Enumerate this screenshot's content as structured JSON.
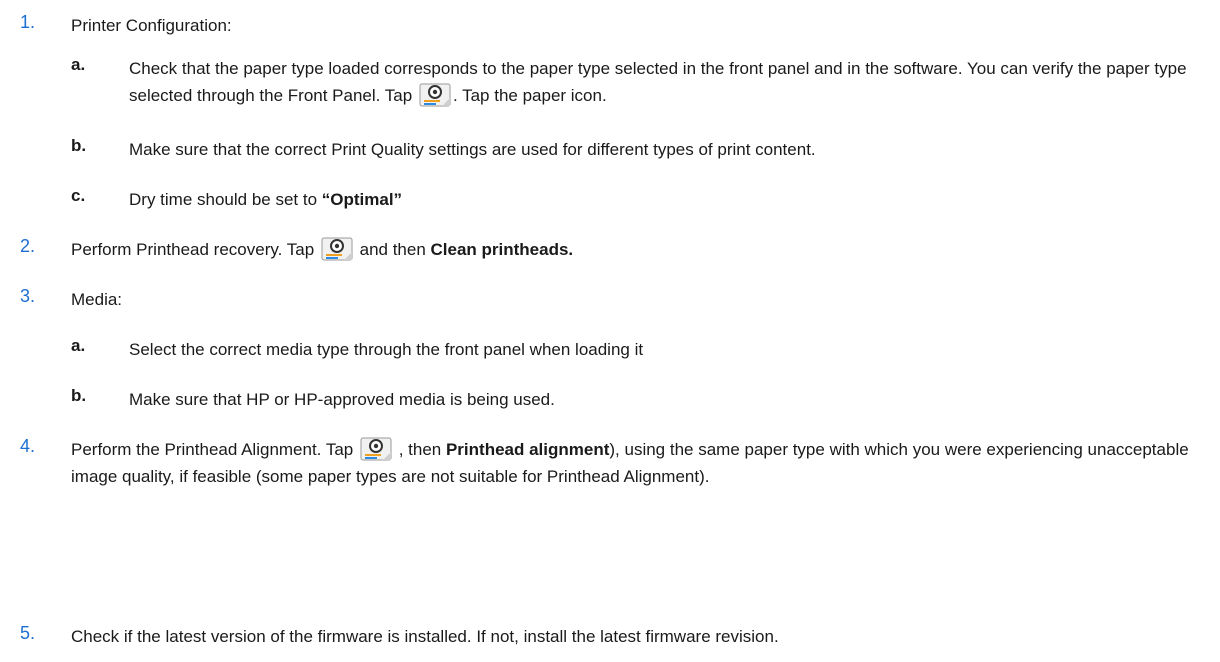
{
  "steps": [
    {
      "num": "1.",
      "text": "Printer Configuration:"
    },
    {
      "num": "2.",
      "pre": "Perform Printhead recovery. Tap",
      "mid": " and then ",
      "bold": "Clean printheads."
    },
    {
      "num": "3.",
      "text": "Media:"
    },
    {
      "num": "4.",
      "pre": "Perform the Printhead Alignment. Tap",
      "mid": " , then ",
      "bold": "Printhead alignment",
      "post": "), using the same paper type with which you were experiencing unacceptable image quality, if feasible (some paper types are not suitable for Printhead Alignment)."
    },
    {
      "num": "5.",
      "text": "Check if the latest version of the firmware is installed. If not, install the latest firmware revision."
    }
  ],
  "step1_subs": [
    {
      "letter": "a.",
      "pre": "Check that the paper type loaded corresponds to the paper type selected in the front panel and in the software. You can verify the paper type selected through the Front Panel. Tap",
      "post": ". Tap the paper icon."
    },
    {
      "letter": "b.",
      "text": "Make sure that the correct Print Quality settings are used for different types of print content."
    },
    {
      "letter": "c.",
      "pre": "Dry time should be set to ",
      "bold": "“Optimal”"
    }
  ],
  "step3_subs": [
    {
      "letter": "a.",
      "text": "Select the correct media type through the front panel when loading it"
    },
    {
      "letter": "b.",
      "text": "Make sure that HP or HP-approved media is being used."
    }
  ],
  "icons": {
    "settings": "settings-icon"
  },
  "colors": {
    "accent": "#1c6fd1",
    "text": "#1a1a1a"
  }
}
